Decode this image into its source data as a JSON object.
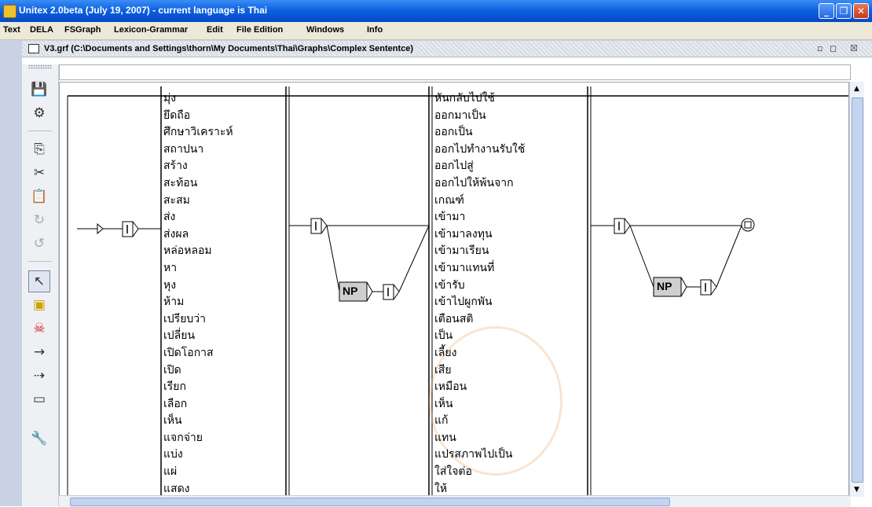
{
  "window": {
    "title": "Unitex 2.0beta (July 19, 2007) - current language is Thai",
    "buttons": [
      "minimize",
      "maximize",
      "close"
    ]
  },
  "menu": [
    "Text",
    "DELA",
    "FSGraph",
    "Lexicon-Grammar",
    "Edit",
    "File Edition",
    "Windows",
    "Info"
  ],
  "internal_frame": {
    "title": "V3.grf (C:\\Documents and Settings\\thorn\\My Documents\\Thai\\Graphs\\Complex Sententce)"
  },
  "toolbar": {
    "icons": [
      "save-icon",
      "compile-icon",
      "copy-icon",
      "cut-icon",
      "paste-icon",
      "redo-icon",
      "undo-icon",
      "pointer-icon",
      "open-box-icon",
      "kill-icon",
      "link-icon",
      "reverse-link-icon",
      "box-icon",
      "configure-icon"
    ]
  },
  "graph": {
    "left_words": [
      "มุ่ง",
      "ยึดถือ",
      "ศึกษาวิเคราะห์",
      "สถาปนา",
      "สร้าง",
      "สะท้อน",
      "สะสม",
      "ส่ง",
      "ส่งผล",
      "หล่อหลอม",
      "หา",
      "หุง",
      "ห้าม",
      "เปรียบว่า",
      "เปลี่ยน",
      "เปิดโอกาส",
      "เปิด",
      "เรียก",
      "เลือก",
      "เห็น",
      "แจกจ่าย",
      "แบ่ง",
      "แผ่",
      "แสดง"
    ],
    "right_words": [
      "หันกลับไปใช้",
      "ออกมาเป็น",
      "ออกเป็น",
      "ออกไปทำงานรับใช้",
      "ออกไปสู่",
      "ออกไปให้พ้นจาก",
      "เกณฑ์",
      "เข้ามา",
      "เข้ามาลงทุน",
      "เข้ามาเรียน",
      "เข้ามาแทนที่",
      "เข้ารับ",
      "เข้าไปผูกพัน",
      "เตือนสติ",
      "เป็น",
      "เลี้ยง",
      "เสีย",
      "เหมือน",
      "เห็น",
      "แก้",
      "แทน",
      "แปรสภาพไปเป็น",
      "ใส่ใจต่อ",
      "ให้"
    ],
    "np_label": "NP"
  }
}
